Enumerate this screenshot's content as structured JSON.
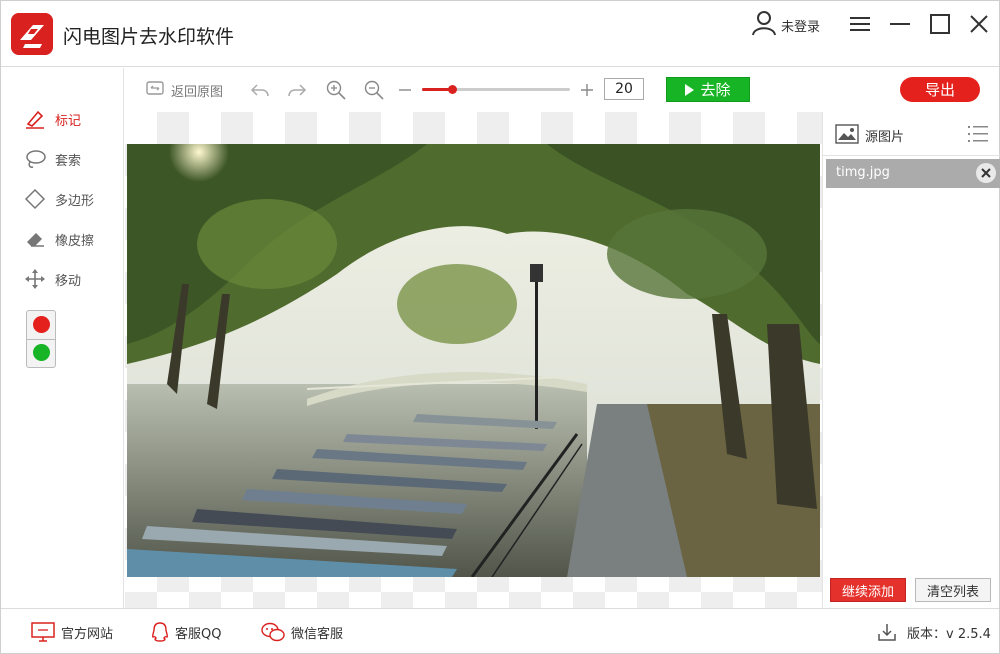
{
  "app": {
    "title": "闪电图片去水印软件",
    "brand_color": "#d9221f"
  },
  "header": {
    "user_label": "未登录"
  },
  "tools": [
    {
      "label": "标记",
      "icon": "brush-icon"
    },
    {
      "label": "套索",
      "icon": "lasso-icon"
    },
    {
      "label": "多边形",
      "icon": "polygon-icon"
    },
    {
      "label": "橡皮擦",
      "icon": "eraser-icon"
    },
    {
      "label": "移动",
      "icon": "move-icon"
    }
  ],
  "colors": {
    "red": "#e4211d",
    "green": "#17b525"
  },
  "toolbar": {
    "restore_label": "返回原图",
    "zoom_value": "20",
    "brush_size_fraction": 0.2,
    "remove_label": "去除",
    "export_label": "导出"
  },
  "file_panel": {
    "title": "源图片",
    "files": [
      {
        "name": "timg.jpg"
      }
    ],
    "add_label": "继续添加",
    "clear_label": "清空列表"
  },
  "footer": {
    "website_label": "官方网站",
    "qq_label": "客服QQ",
    "wechat_label": "微信客服",
    "version_label": "版本：v 2.5.4"
  }
}
